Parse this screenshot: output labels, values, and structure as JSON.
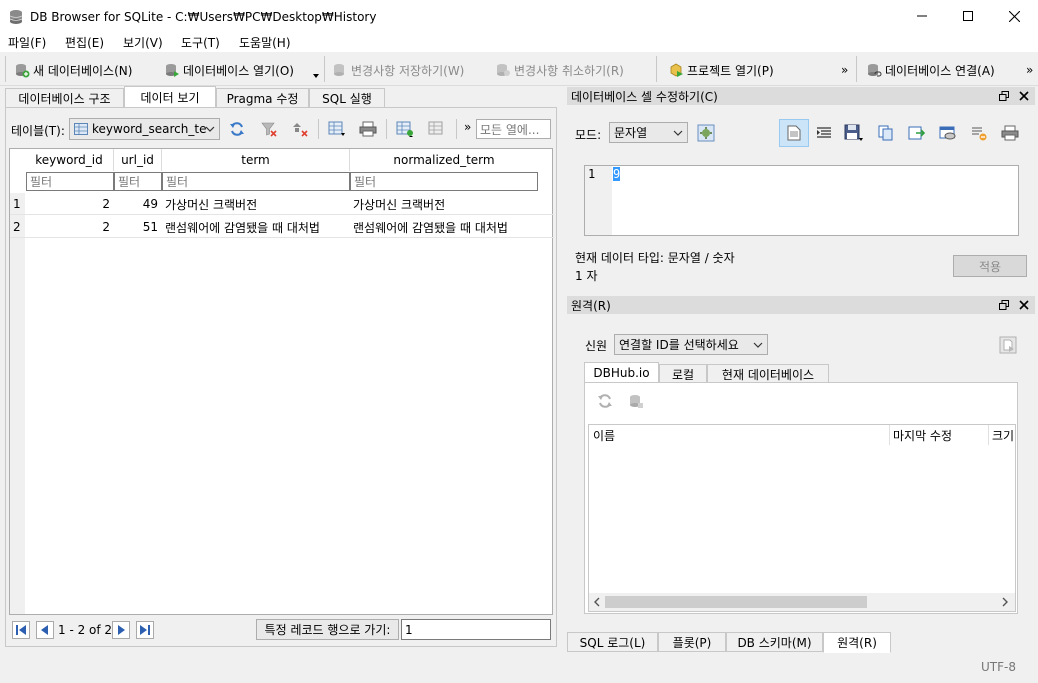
{
  "window": {
    "title": "DB Browser for SQLite - C:₩Users₩PC₩Desktop₩History",
    "minimize_icon": "minimize-icon",
    "maximize_icon": "maximize-icon",
    "close_icon": "close-icon"
  },
  "menu": [
    {
      "label": "파일(F)"
    },
    {
      "label": "편집(E)"
    },
    {
      "label": "보기(V)"
    },
    {
      "label": "도구(T)"
    },
    {
      "label": "도움말(H)"
    }
  ],
  "toolbar": {
    "new_db": "새 데이터베이스(N)",
    "open_db": "데이터베이스 열기(O)",
    "write_changes": "변경사항 저장하기(W)",
    "revert_changes": "변경사항 취소하기(R)",
    "open_project": "프로젝트 열기(P)",
    "attach_db": "데이터베이스 연결(A)",
    "overflow": "»"
  },
  "main_tabs": [
    {
      "label": "데이터베이스 구조",
      "active": false
    },
    {
      "label": "데이터 보기",
      "active": true
    },
    {
      "label": "Pragma 수정",
      "active": false
    },
    {
      "label": "SQL 실행",
      "active": false
    }
  ],
  "browse": {
    "table_label": "테이블(T):",
    "table_value": "keyword_search_te",
    "overflow": "»",
    "filter_all_placeholder": "모든 열에...",
    "columns": [
      "keyword_id",
      "url_id",
      "term",
      "normalized_term"
    ],
    "filter_placeholder": "필터",
    "rows": [
      {
        "rownum": "1",
        "keyword_id": "2",
        "url_id": "49",
        "term": "가상머신 크랙버전",
        "normalized_term": "가상머신 크랙버전"
      },
      {
        "rownum": "2",
        "keyword_id": "2",
        "url_id": "51",
        "term": "랜섬웨어에 감염됐을 때 대처법",
        "normalized_term": "랜섬웨어에 감염됐을 때 대처법"
      }
    ],
    "pager_text": "1 - 2 of 2",
    "goto_button": "특정 레코드 행으로 가기:",
    "goto_value": "1"
  },
  "edit_cell": {
    "title": "데이터베이스 셀 수정하기(C)",
    "mode_label": "모드:",
    "mode_value": "문자열",
    "line_number": "1",
    "value": "9",
    "type_text": "현재 데이터 타입: 문자열 / 숫자",
    "size_text": "1 자",
    "apply_button": "적용"
  },
  "remote": {
    "title": "원격(R)",
    "identity_label": "신원",
    "identity_value": "연결할 ID를 선택하세요",
    "tabs": [
      {
        "label": "DBHub.io",
        "active": true
      },
      {
        "label": "로컬",
        "active": false
      },
      {
        "label": "현재 데이터베이스",
        "active": false
      }
    ],
    "columns": [
      "이름",
      "마지막 수정",
      "크기"
    ]
  },
  "bottom_tabs": [
    {
      "label": "SQL 로그(L)",
      "active": false
    },
    {
      "label": "플롯(P)",
      "active": false
    },
    {
      "label": "DB 스키마(M)",
      "active": false
    },
    {
      "label": "원격(R)",
      "active": true
    }
  ],
  "status": {
    "encoding": "UTF-8"
  }
}
